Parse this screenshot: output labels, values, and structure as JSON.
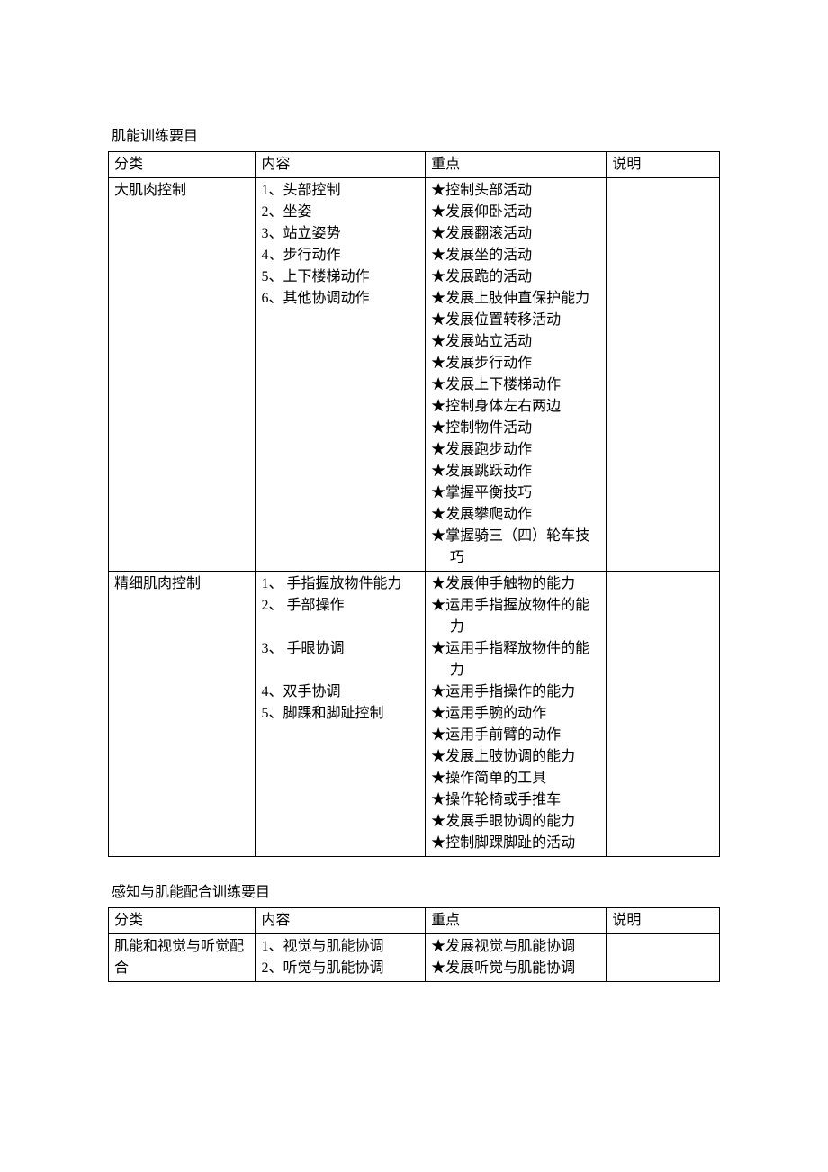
{
  "section1": {
    "title": "肌能训练要目",
    "headers": {
      "c1": "分类",
      "c2": "内容",
      "c3": "重点",
      "c4": "说明"
    },
    "rows": [
      {
        "category": "大肌肉控制",
        "content": [
          "1、头部控制",
          "2、坐姿",
          "3、站立姿势",
          "4、步行动作",
          "5、上下楼梯动作",
          "6、其他协调动作"
        ],
        "points": [
          "★控制头部活动",
          "★发展仰卧活动",
          "★发展翻滚活动",
          "★发展坐的活动",
          "★发展跪的活动",
          "★发展上肢伸直保护能力",
          "★发展位置转移活动",
          "★发展站立活动",
          "★发展步行动作",
          "★发展上下楼梯动作",
          "★控制身体左右两边",
          "★控制物件活动",
          "★发展跑步动作",
          "★发展跳跃动作",
          "★掌握平衡技巧",
          "★发展攀爬动作",
          "★掌握骑三（四）轮车技巧"
        ],
        "note": ""
      },
      {
        "category": "精细肌肉控制",
        "content": [
          "1、 手指握放物件能力",
          "2、 手部操作",
          "",
          "3、 手眼协调",
          "",
          "4、双手协调",
          "5、脚踝和脚趾控制"
        ],
        "points": [
          "★发展伸手触物的能力",
          "★运用手指握放物件的能力",
          "★运用手指释放物件的能力",
          "★运用手指操作的能力",
          "★运用手腕的动作",
          "★运用手前臂的动作",
          "★发展上肢协调的能力",
          "★操作简单的工具",
          "★操作轮椅或手推车",
          "★发展手眼协调的能力",
          "★控制脚踝脚趾的活动"
        ],
        "note": ""
      }
    ]
  },
  "section2": {
    "title": "感知与肌能配合训练要目",
    "headers": {
      "c1": "分类",
      "c2": "内容",
      "c3": "重点",
      "c4": "说明"
    },
    "rows": [
      {
        "category": "肌能和视觉与听觉配合",
        "content": [
          "1、视觉与肌能协调",
          "2、听觉与肌能协调"
        ],
        "points": [
          "★发展视觉与肌能协调",
          "★发展听觉与肌能协调"
        ],
        "note": ""
      }
    ]
  }
}
